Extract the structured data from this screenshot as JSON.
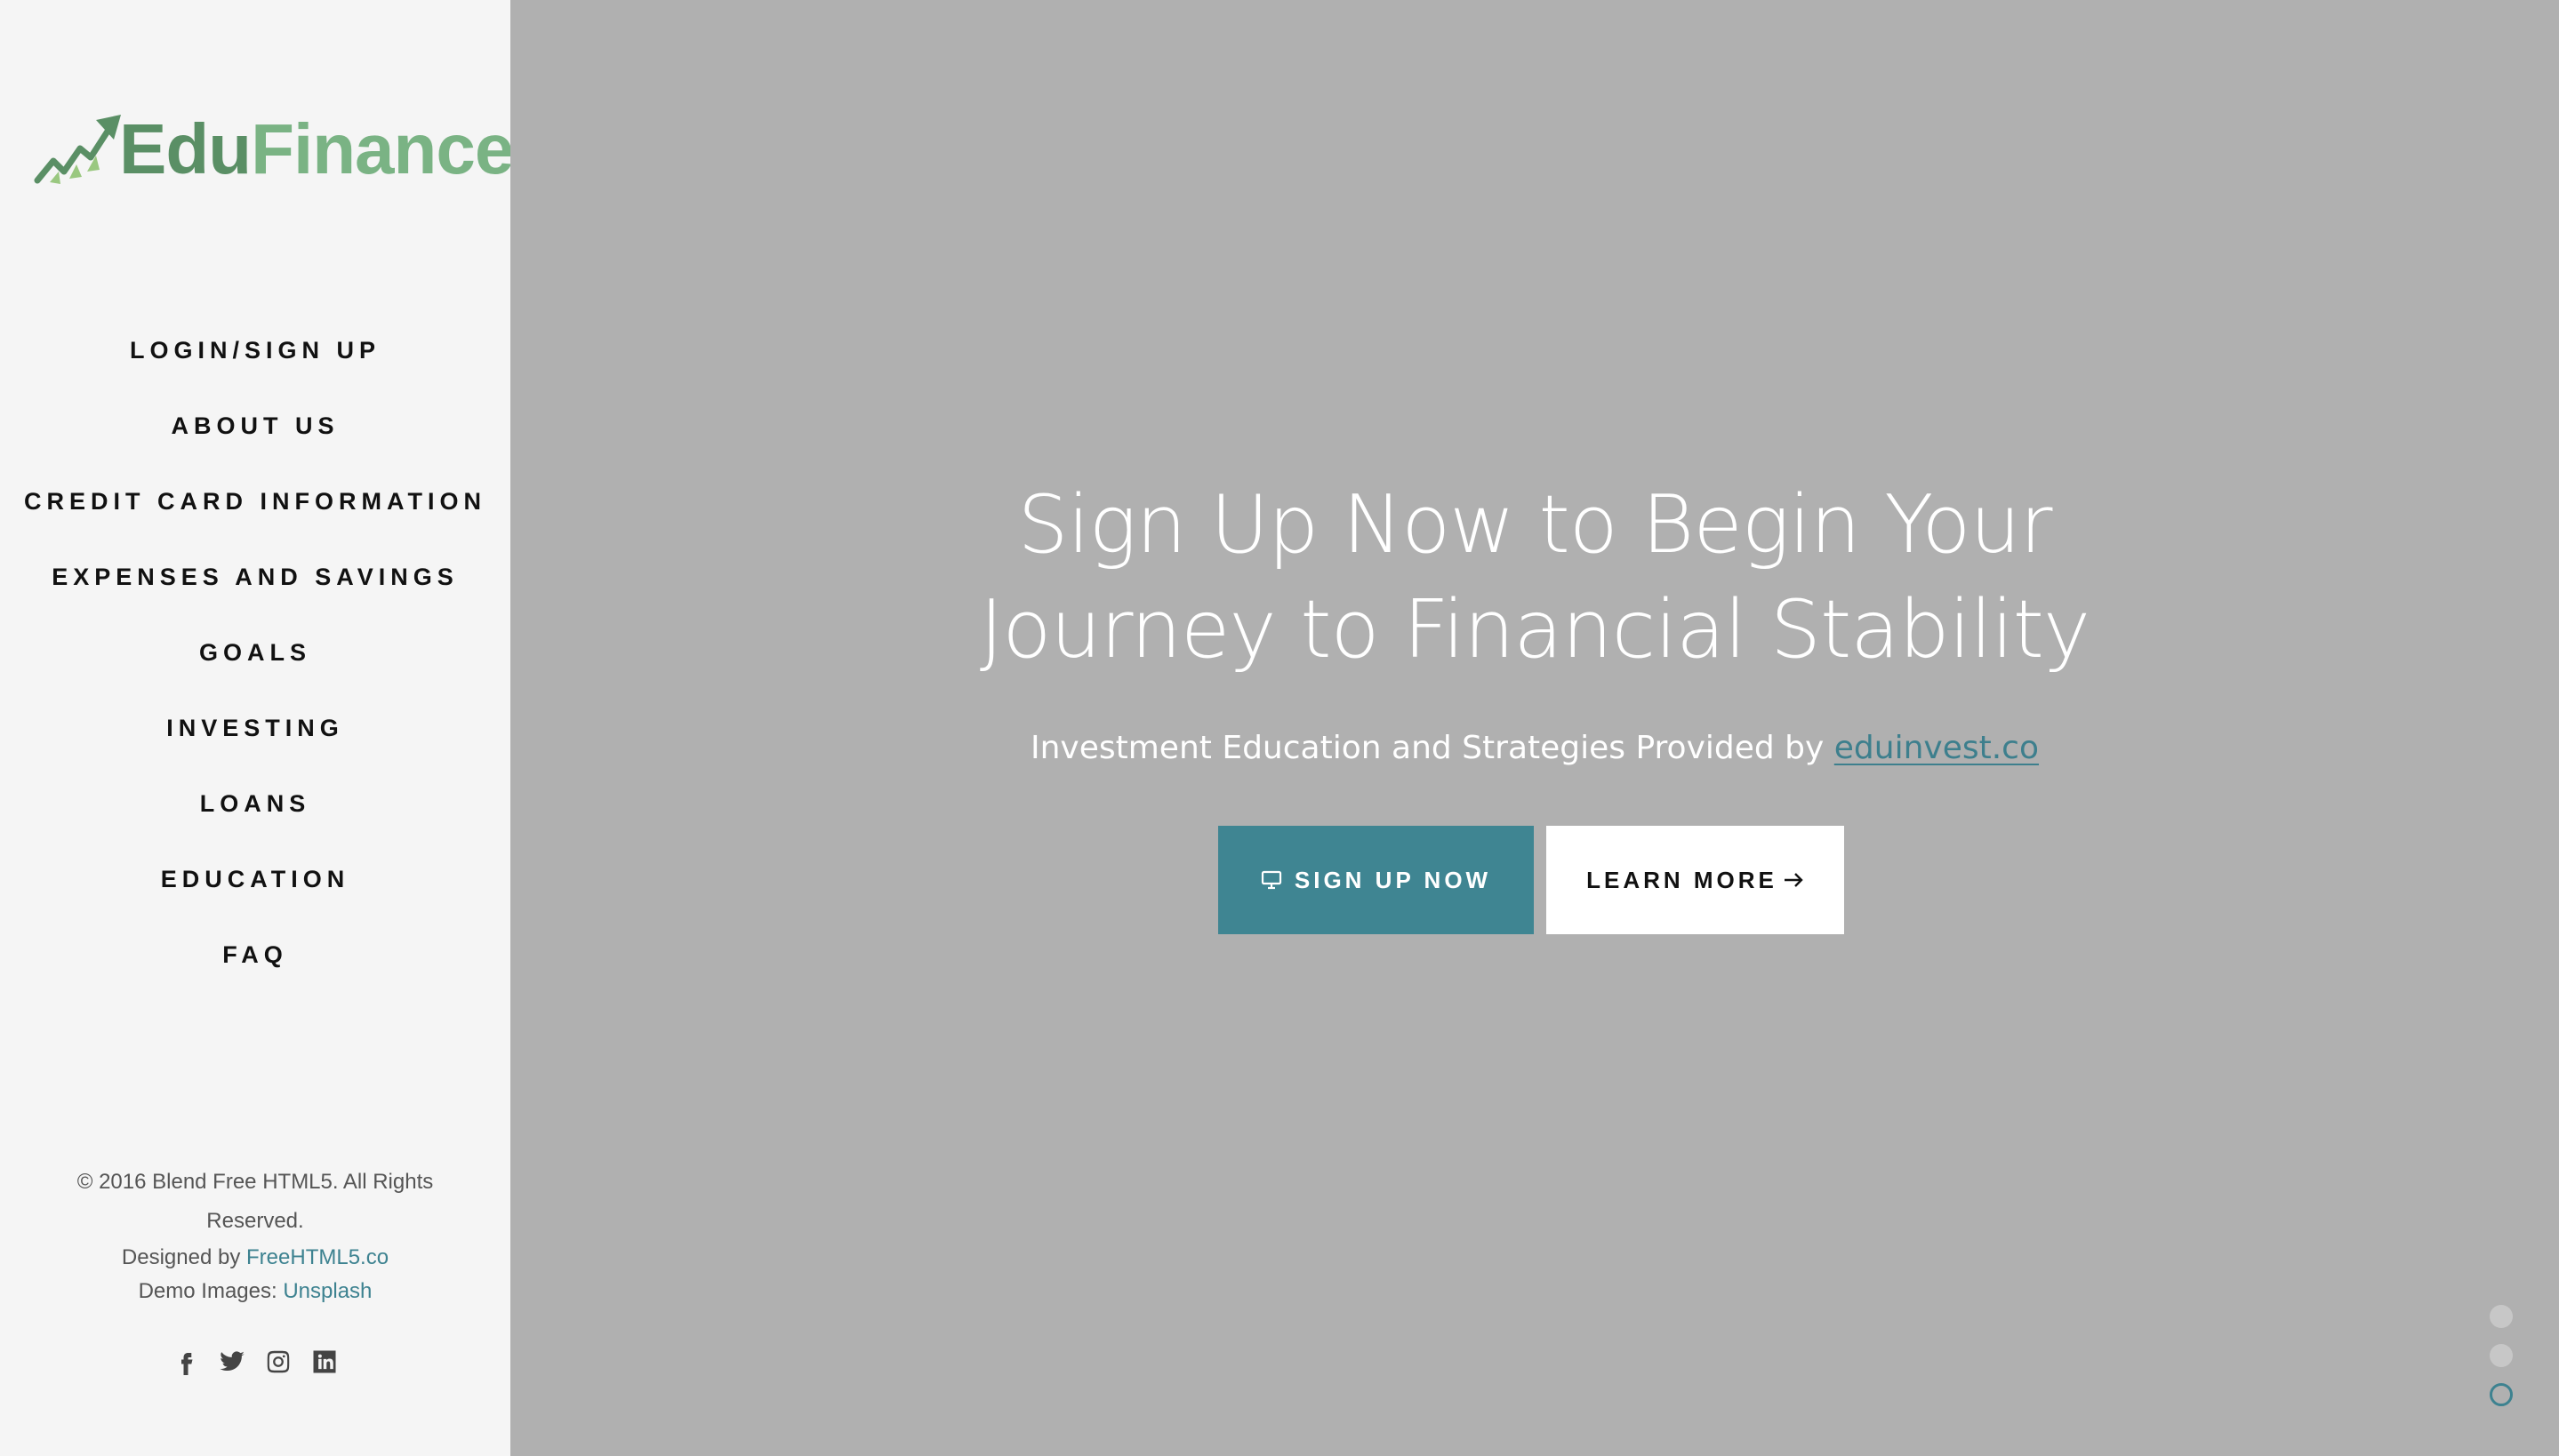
{
  "sidebar": {
    "logo": {
      "part1": "Edu",
      "part2": "Finance",
      "colors": {
        "primary": "#5a8f65",
        "secondary": "#7ab384"
      }
    },
    "nav": [
      {
        "label": "LOGIN/SIGN UP"
      },
      {
        "label": "ABOUT US"
      },
      {
        "label": "CREDIT CARD INFORMATION"
      },
      {
        "label": "EXPENSES AND SAVINGS"
      },
      {
        "label": "GOALS"
      },
      {
        "label": "INVESTING"
      },
      {
        "label": "LOANS"
      },
      {
        "label": "EDUCATION"
      },
      {
        "label": "FAQ"
      }
    ],
    "footer": {
      "copyright": "© 2016 Blend Free HTML5. All Rights Reserved.",
      "designed_prefix": "Designed by ",
      "designed_link": "FreeHTML5.co",
      "images_prefix": "Demo Images: ",
      "images_link": "Unsplash"
    },
    "social": [
      "facebook-icon",
      "twitter-icon",
      "instagram-icon",
      "linkedin-icon"
    ]
  },
  "hero": {
    "title_line1": "Sign Up Now to Begin Your",
    "title_line2": "Journey to Financial Stability",
    "subtitle_prefix": "Investment Education and Strategies Provided by ",
    "subtitle_link": "eduinvest.co",
    "primary_button": {
      "label": "SIGN UP NOW",
      "icon": "monitor-icon"
    },
    "secondary_button": {
      "label": "LEARN MORE",
      "icon": "arrow-right-icon"
    },
    "slider": {
      "count": 3,
      "active_index": 2
    },
    "colors": {
      "accent": "#3f8592",
      "background": "#b0b0b0"
    }
  }
}
